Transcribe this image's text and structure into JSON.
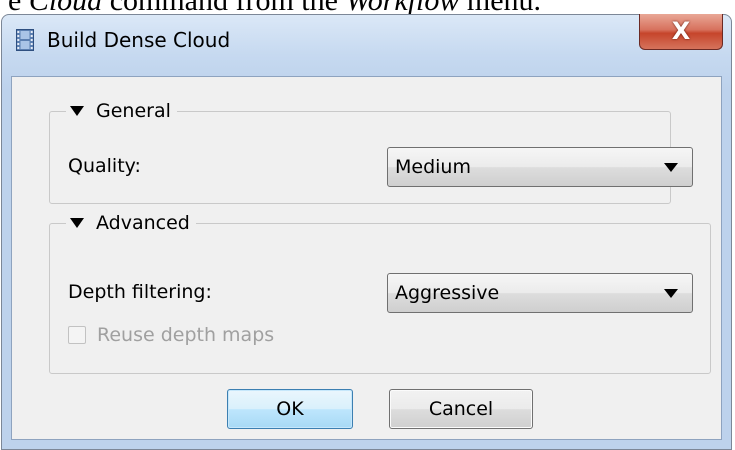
{
  "doc_caption": {
    "prefix": "e ",
    "italic1": "Cloud",
    "middle": " command from the ",
    "italic2": "Workflow",
    "suffix": " menu."
  },
  "window": {
    "title": "Build Dense Cloud",
    "close_glyph": "X",
    "app_icon": "film-strip-icon"
  },
  "general": {
    "section_label": "General",
    "quality_label": "Quality:",
    "quality_value": "Medium"
  },
  "advanced": {
    "section_label": "Advanced",
    "depth_filtering_label": "Depth filtering:",
    "depth_filtering_value": "Aggressive",
    "reuse_depth_maps_label": "Reuse depth maps",
    "reuse_depth_maps_checked": false,
    "reuse_depth_maps_enabled": false
  },
  "buttons": {
    "ok_label": "OK",
    "cancel_label": "Cancel"
  },
  "colors": {
    "window_frame": "#c6d9f0",
    "close_button": "#c6452b",
    "client_bg": "#f0f0f0",
    "default_button": "#bee6fd"
  }
}
